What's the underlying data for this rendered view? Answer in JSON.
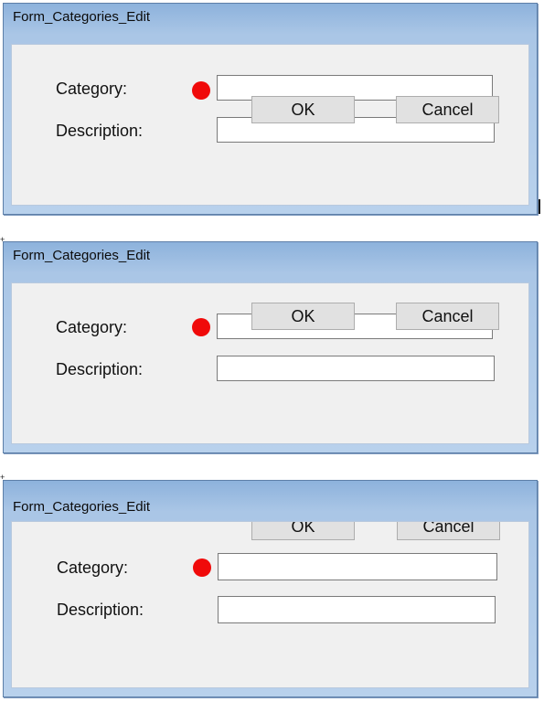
{
  "frames": [
    {
      "title": "Form_Categories_Edit",
      "category_label": "Category:",
      "description_label": "Description:",
      "category_value": "",
      "description_value": "",
      "ok_label": "OK",
      "cancel_label": "Cancel"
    },
    {
      "title": "Form_Categories_Edit",
      "category_label": "Category:",
      "description_label": "Description:",
      "category_value": "",
      "description_value": "",
      "ok_label": "OK",
      "cancel_label": "Cancel"
    },
    {
      "title": "Form_Categories_Edit",
      "category_label": "Category:",
      "description_label": "Description:",
      "category_value": "",
      "description_value": "",
      "ok_label": "OK",
      "cancel_label": "Cancel"
    }
  ],
  "colors": {
    "required_indicator": "#f00a0a",
    "titlebar": "#aac6e6",
    "client_area": "#f0f0f0"
  },
  "icons": [
    "required-indicator-icon"
  ]
}
